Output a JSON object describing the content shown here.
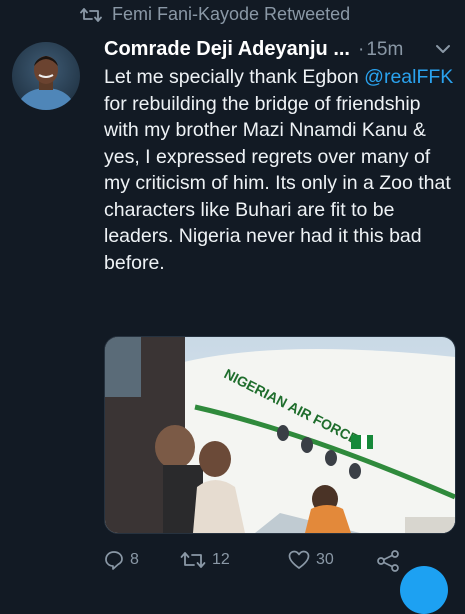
{
  "retweet": {
    "label": "Femi Fani-Kayode Retweeted",
    "icon": "retweet-icon"
  },
  "tweet": {
    "author": "Comrade Deji Adeyanju ...",
    "separator": "·",
    "time": "15m",
    "text_before_mention": "Let me specially thank Egbon ",
    "mention": "@realFFK",
    "text_after_mention": " for rebuilding the bridge of friendship with my brother Mazi Nnamdi Kanu & yes, I expressed regrets over many of my criticism of him. Its only in a Zoo that characters like Buhari are fit to be leaders. Nigeria never had it this bad before.",
    "media": {
      "aircraft_text": "NIGERIAN AIR FORCE"
    }
  },
  "actions": {
    "reply_count": "8",
    "retweet_count": "12",
    "like_count": "30"
  },
  "colors": {
    "background": "#121a24",
    "secondary_text": "#8a98a6",
    "link": "#2aa3ef",
    "fab": "#1da1f2"
  }
}
